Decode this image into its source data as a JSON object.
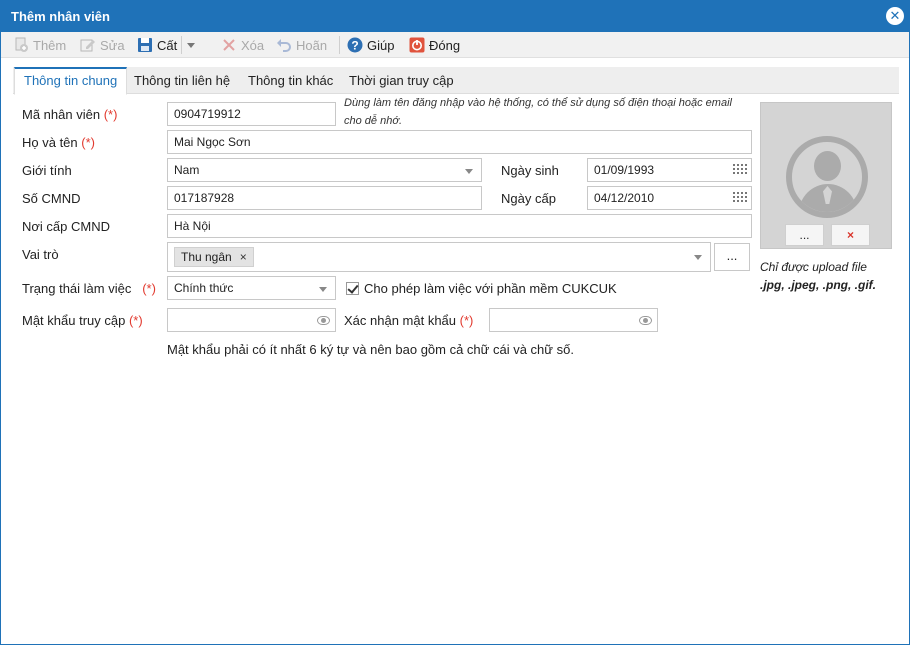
{
  "window": {
    "title": "Thêm nhân viên"
  },
  "toolbar": {
    "add_label": "Thêm",
    "edit_label": "Sửa",
    "save_label": "Cất",
    "delete_label": "Xóa",
    "undo_label": "Hoãn",
    "help_label": "Giúp",
    "close_label": "Đóng"
  },
  "tabs": [
    {
      "label": "Thông tin chung"
    },
    {
      "label": "Thông tin liên hệ"
    },
    {
      "label": "Thông tin khác"
    },
    {
      "label": "Thời gian truy cập"
    }
  ],
  "form": {
    "required_mark": "(*)",
    "employee_code": {
      "label": "Mã nhân viên",
      "value": "0904719912"
    },
    "employee_code_hint": "Dùng làm tên đăng nhập vào hệ thống, có thể sử dụng số điện thoại hoặc email cho dễ nhớ.",
    "full_name": {
      "label": "Họ và tên",
      "value": "Mai Ngọc Sơn"
    },
    "gender": {
      "label": "Giới tính",
      "value": "Nam"
    },
    "birth_date": {
      "label": "Ngày sinh",
      "value": "01/09/1993"
    },
    "id_number": {
      "label": "Số CMND",
      "value": "017187928"
    },
    "issue_date": {
      "label": "Ngày cấp",
      "value": "04/12/2010"
    },
    "issue_place": {
      "label": "Nơi cấp CMND",
      "value": "Hà Nội"
    },
    "role": {
      "label": "Vai trò",
      "tag": "Thu ngân",
      "tag_remove": "×",
      "more_button": "..."
    },
    "work_status": {
      "label": "Trạng thái làm việc",
      "value": "Chính thức"
    },
    "allow_cukcuk": {
      "label": "Cho phép làm việc với phần mềm CUKCUK",
      "checked": true
    },
    "password": {
      "label": "Mật khẩu truy cập",
      "value": ""
    },
    "confirm_password": {
      "label": "Xác nhận mật khẩu",
      "value": ""
    },
    "password_hint": "Mật khẩu phải có ít nhất 6 ký tự và nên bao gồm cả chữ cái và chữ số."
  },
  "photo": {
    "browse_button": "...",
    "remove_button": "×",
    "note_line1": "Chỉ được upload file",
    "note_line2": ".jpg, .jpeg, .png, .gif."
  },
  "colors": {
    "accent": "#1f72b8",
    "required": "#e23a2f",
    "remove": "#d9342b"
  }
}
